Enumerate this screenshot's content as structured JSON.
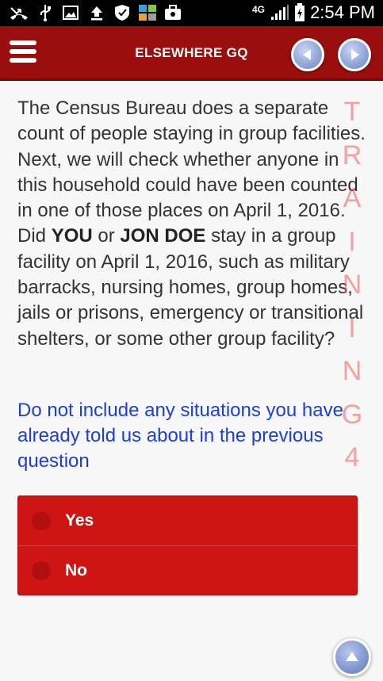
{
  "status_bar": {
    "time": "2:54 PM",
    "network": "4G",
    "icons": [
      "missed-call-icon",
      "usb-icon",
      "image-icon",
      "upload-icon",
      "shield-icon",
      "apps-icon",
      "briefcase-icon",
      "signal-icon",
      "battery-icon"
    ]
  },
  "header": {
    "title": "ELSEWHERE GQ",
    "menu_icon": "hamburger-menu-icon",
    "prev_icon": "arrow-left-icon",
    "next_icon": "arrow-right-icon"
  },
  "question": {
    "part1": "The Census Bureau does a separate count of people staying in group facilities. Next, we will check whether anyone in this household could have been counted in one of those places on April 1, 2016. Did ",
    "bold1": "YOU",
    "part2": " or ",
    "bold2": "JON DOE",
    "part3": " stay in a group facility on April 1, 2016, such as military barracks, nursing homes, group homes, jails or prisons, emergency or transitional shelters, or some other group facility?"
  },
  "instruction": "Do not include any situations you have already told us about in the previous question",
  "watermark": {
    "letters": [
      "T",
      "R",
      "A",
      "I",
      "N",
      "I",
      "N",
      "G",
      "4"
    ]
  },
  "options": [
    {
      "label": "Yes"
    },
    {
      "label": "No"
    }
  ],
  "footer": {
    "scroll_top_icon": "arrow-up-icon"
  },
  "colors": {
    "header_bg": "#9b0e0e",
    "option_bg": "#cf1414",
    "instruction_text": "#1c3fd6",
    "watermark": "#f05a5a"
  }
}
